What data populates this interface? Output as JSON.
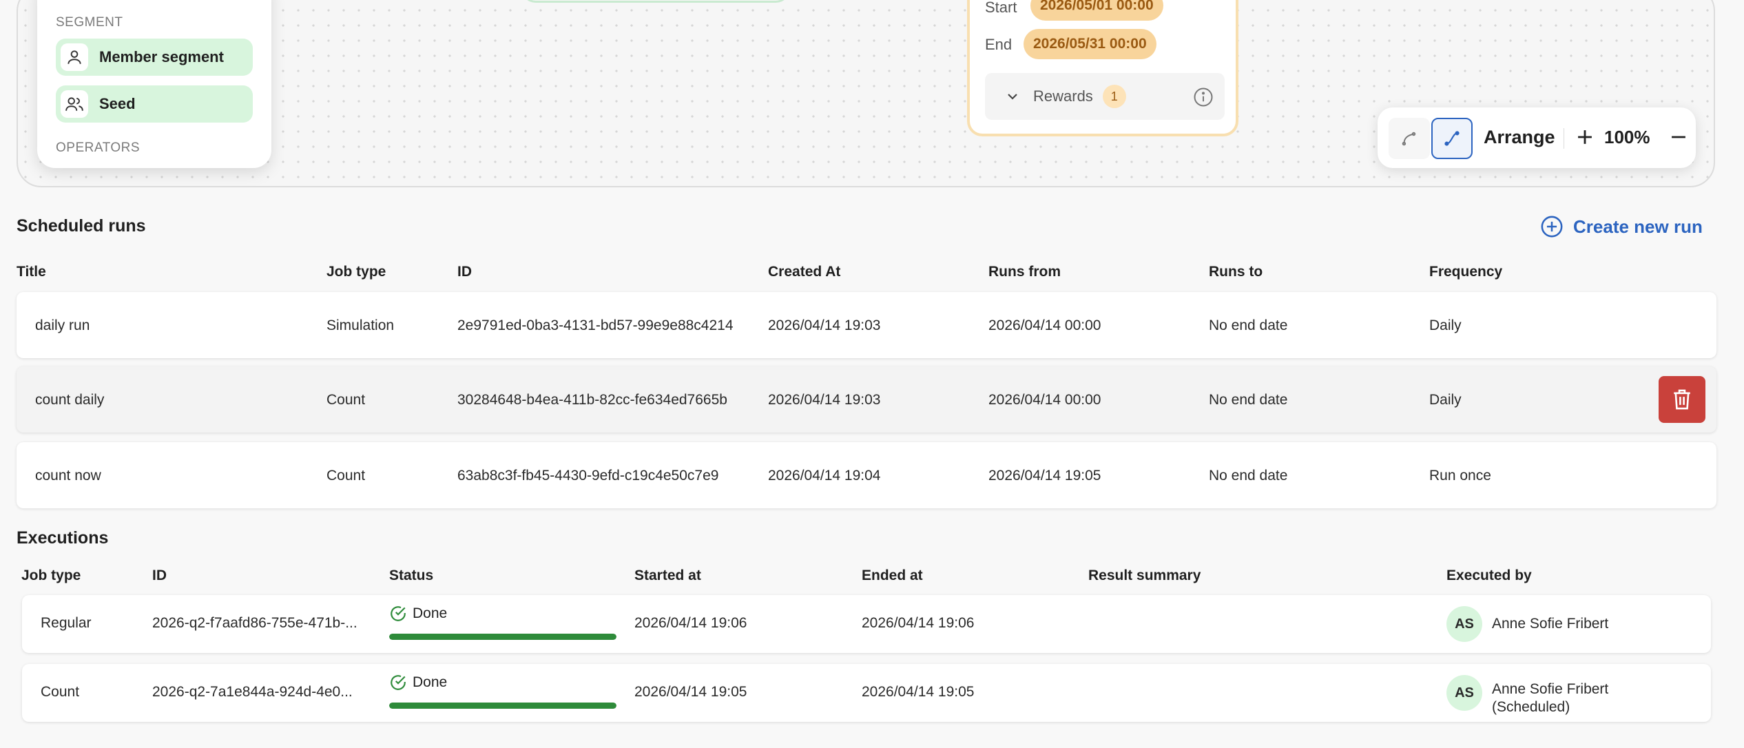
{
  "canvas": {
    "palette": {
      "segment_label": "SEGMENT",
      "operators_label": "OPERATORS",
      "items": [
        {
          "label": "Member segment",
          "icon": "person-icon"
        },
        {
          "label": "Seed",
          "icon": "people-icon"
        }
      ]
    },
    "campaign_card": {
      "start_label": "Start",
      "start_value": "2026/05/01 00:00",
      "end_label": "End",
      "end_value": "2026/05/31 00:00",
      "rewards_label": "Rewards",
      "rewards_count": "1"
    },
    "toolbar": {
      "arrange_label": "Arrange",
      "zoom": "100%"
    }
  },
  "scheduled_runs": {
    "title": "Scheduled runs",
    "create_label": "Create new run",
    "columns": [
      "Title",
      "Job type",
      "ID",
      "Created At",
      "Runs from",
      "Runs to",
      "Frequency"
    ],
    "rows": [
      [
        "daily run",
        "Simulation",
        "2e9791ed-0ba3-4131-bd57-99e9e88c4214",
        "2026/04/14 19:03",
        "2026/04/14 00:00",
        "No end date",
        "Daily"
      ],
      [
        "count daily",
        "Count",
        "30284648-b4ea-411b-82cc-fe634ed7665b",
        "2026/04/14 19:03",
        "2026/04/14 00:00",
        "No end date",
        "Daily"
      ],
      [
        "count now",
        "Count",
        "63ab8c3f-fb45-4430-9efd-c19c4e50c7e9",
        "2026/04/14 19:04",
        "2026/04/14 19:05",
        "No end date",
        "Run once"
      ]
    ]
  },
  "executions": {
    "title": "Executions",
    "columns": [
      "Job type",
      "ID",
      "Status",
      "Started at",
      "Ended at",
      "Result summary",
      "Executed by"
    ],
    "rows": [
      {
        "job_type": "Regular",
        "id": "2026-q2-f7aafd86-755e-471b-...",
        "status": "Done",
        "progress": 1.0,
        "started": "2026/04/14 19:06",
        "ended": "2026/04/14 19:06",
        "summary": "",
        "initials": "AS",
        "executed_by": "Anne Sofie Fribert",
        "executed_by_note": ""
      },
      {
        "job_type": "Count",
        "id": "2026-q2-7a1e844a-924d-4e0...",
        "status": "Done",
        "progress": 1.0,
        "started": "2026/04/14 19:05",
        "ended": "2026/04/14 19:05",
        "summary": "",
        "initials": "AS",
        "executed_by": "Anne Sofie Fribert",
        "executed_by_note": "(Scheduled)"
      }
    ]
  },
  "colors": {
    "accent": "#2c64c0",
    "danger": "#c9413b",
    "success": "#2e8b3a",
    "segment_bg": "#d8f5dd",
    "date_chip": "#f8d49b"
  }
}
